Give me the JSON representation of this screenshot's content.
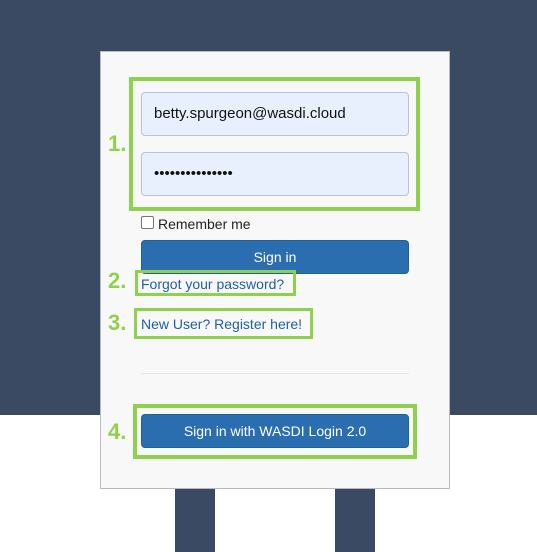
{
  "login": {
    "email_value": "betty.spurgeon@wasdi.cloud",
    "password_masked": "•••••••••••••••",
    "remember_label": "Remember me",
    "signin_label": "Sign in",
    "forgot_link": "Forgot your password?",
    "register_link": "New User? Register here!",
    "wasdi_login_label": "Sign in with WASDI Login 2.0"
  },
  "annotations": {
    "step_1": "1.",
    "step_2": "2.",
    "step_3": "3.",
    "step_4": "4."
  },
  "colors": {
    "background": "#3a4a63",
    "highlight": "#8fd14f",
    "button": "#2a6eb0",
    "link": "#1f5fa8",
    "input_fill": "#e8f0fe"
  }
}
